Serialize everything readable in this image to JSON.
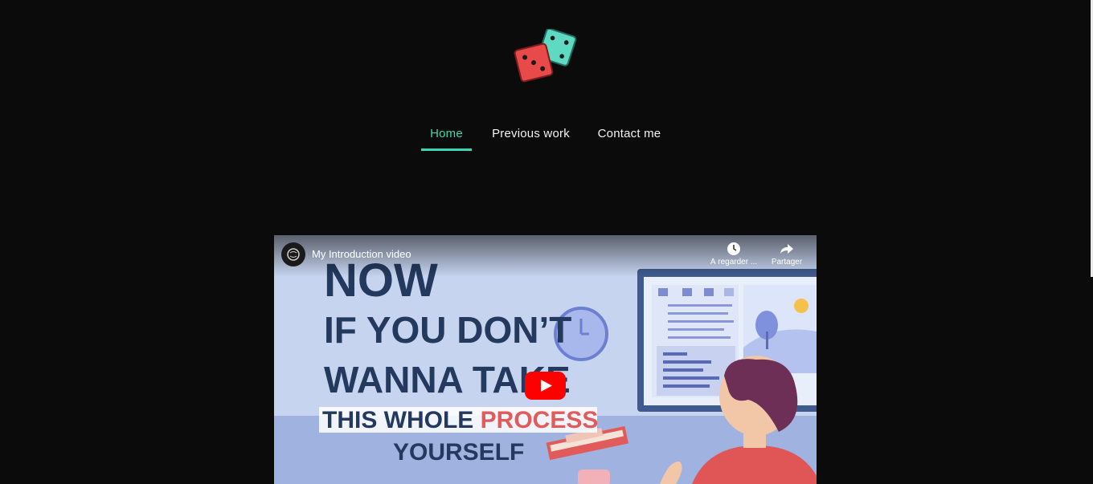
{
  "logo": {
    "icon": "dice-icon",
    "colors": {
      "front_die": "#e84a4a",
      "back_die": "#5fd9c2"
    }
  },
  "nav": {
    "items": [
      {
        "label": "Home",
        "active": true
      },
      {
        "label": "Previous work",
        "active": false
      },
      {
        "label": "Contact me",
        "active": false
      }
    ],
    "accent_color": "#3ed6b0"
  },
  "video": {
    "title": "My Introduction video",
    "actions": [
      {
        "icon": "clock-icon",
        "label": "À regarder ..."
      },
      {
        "icon": "share-icon",
        "label": "Partager"
      }
    ],
    "thumbnail_text": {
      "line1": "NOW",
      "line2": "IF YOU DON’T",
      "line3": "WANNA TAKE",
      "line4a": "THIS WHOLE ",
      "line4b": "PROCESS",
      "line5": "YOURSELF"
    },
    "play_icon": "youtube-play-icon"
  }
}
